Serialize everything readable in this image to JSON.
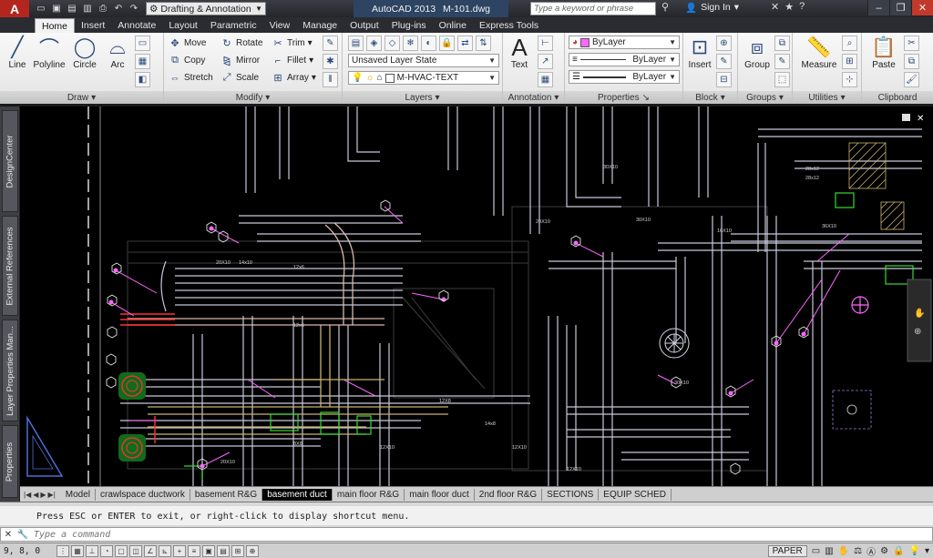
{
  "title_bar": {
    "workspace": "Drafting & Annotation",
    "app_name": "AutoCAD 2013",
    "file_name": "M-101.dwg",
    "search_placeholder": "Type a keyword or phrase",
    "signin": "Sign In"
  },
  "ribbon_tabs": [
    "Home",
    "Insert",
    "Annotate",
    "Layout",
    "Parametric",
    "View",
    "Manage",
    "Output",
    "Plug-ins",
    "Online",
    "Express Tools"
  ],
  "ribbon": {
    "draw": {
      "title": "Draw",
      "line": "Line",
      "polyline": "Polyline",
      "circle": "Circle",
      "arc": "Arc"
    },
    "modify": {
      "title": "Modify",
      "move": "Move",
      "rotate": "Rotate",
      "trim": "Trim",
      "copy": "Copy",
      "mirror": "Mirror",
      "fillet": "Fillet",
      "stretch": "Stretch",
      "scale": "Scale",
      "array": "Array"
    },
    "layers": {
      "title": "Layers",
      "layer_state": "Unsaved Layer State",
      "current_layer": "M-HVAC-TEXT"
    },
    "annotation": {
      "title": "Annotation",
      "text": "Text"
    },
    "properties": {
      "title": "Properties",
      "color": "ByLayer",
      "linetype": "ByLayer",
      "lineweight": "ByLayer"
    },
    "block": {
      "title": "Block",
      "insert": "Insert"
    },
    "groups": {
      "title": "Groups",
      "group": "Group"
    },
    "utilities": {
      "title": "Utilities",
      "measure": "Measure"
    },
    "clipboard": {
      "title": "Clipboard",
      "paste": "Paste"
    }
  },
  "palettes": [
    "DesignCenter",
    "External References",
    "Layer Properties Man...",
    "Properties"
  ],
  "layout_tabs": [
    "Model",
    "crawlspace ductwork",
    "basement R&G",
    "basement duct",
    "main floor R&G",
    "main floor duct",
    "2nd floor R&G",
    "SECTIONS",
    "EQUIP SCHED"
  ],
  "active_layout": "basement duct",
  "command": {
    "history": "Press ESC or ENTER to exit, or right-click to display shortcut menu.",
    "placeholder": "Type a command"
  },
  "status": {
    "coords": "9, 8, 0",
    "space": "PAPER"
  },
  "colors": {
    "background": "#000000",
    "duct_lines": "#c8c8dc",
    "tag_magenta": "#ff66ff",
    "fan_red": "#ff3030",
    "green": "#33dd33"
  }
}
